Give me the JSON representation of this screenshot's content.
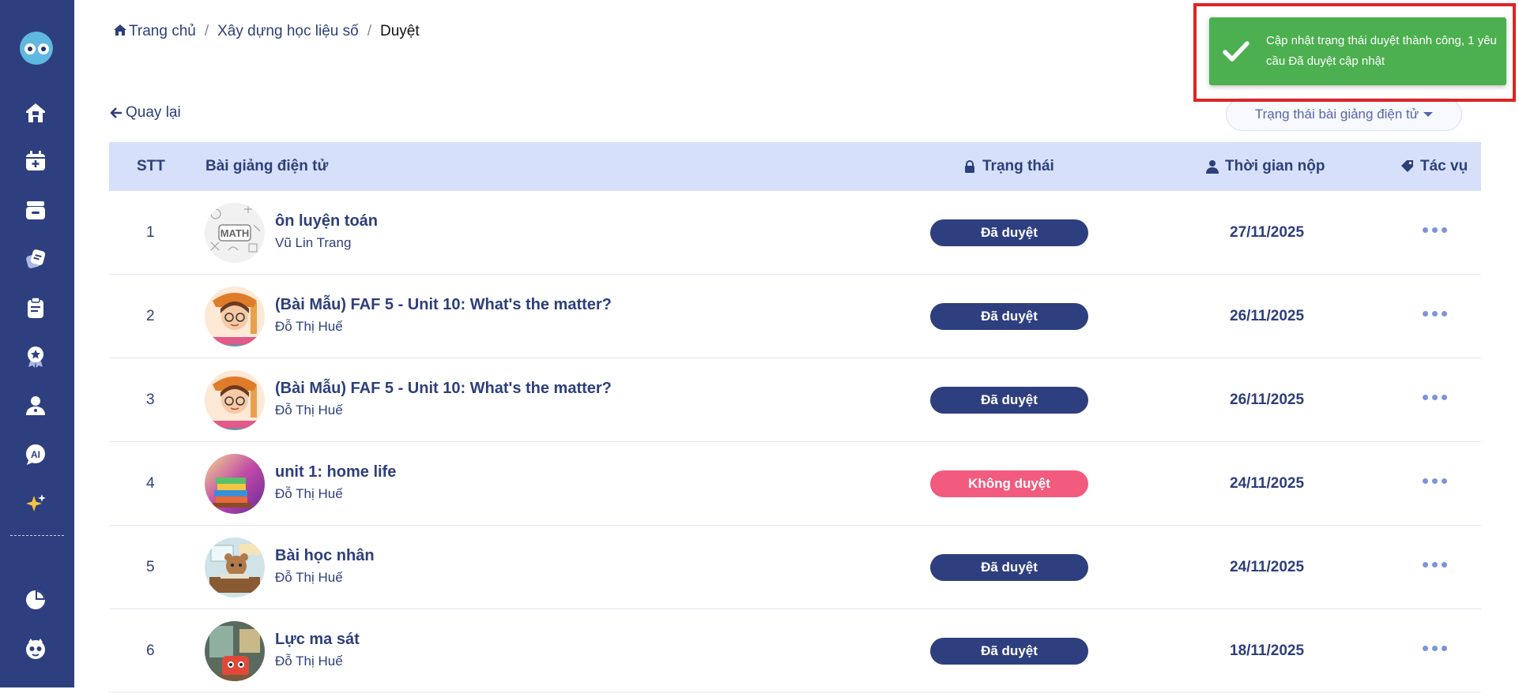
{
  "sidebar": {
    "items": [
      {
        "name": "home-icon"
      },
      {
        "name": "calendar-plus-icon"
      },
      {
        "name": "archive-icon"
      },
      {
        "name": "notes-icon"
      },
      {
        "name": "clipboard-icon"
      },
      {
        "name": "award-icon"
      },
      {
        "name": "users-icon"
      },
      {
        "name": "ai-chat-icon"
      },
      {
        "name": "sparkle-icon"
      },
      {
        "name": "pie-chart-icon"
      },
      {
        "name": "bot-icon"
      }
    ]
  },
  "breadcrumb": {
    "home": "Trang chủ",
    "sep": "/",
    "section": "Xây dựng học liệu số",
    "current": "Duyệt"
  },
  "back_label": "Quay lại",
  "status_filter": {
    "label": "Trạng thái bài giảng điện tử"
  },
  "toast": {
    "message": "Cập nhật trạng thái duyệt thành công, 1 yêu cầu Đã duyệt cập nhật",
    "color": "#4caf50",
    "highlight_color": "#e02424"
  },
  "table": {
    "headers": {
      "stt": "STT",
      "lesson": "Bài giảng điện tử",
      "status": "Trạng thái",
      "time": "Thời gian nộp",
      "actions": "Tác vụ"
    },
    "rows": [
      {
        "stt": "1",
        "title": "ôn luyện toán",
        "author": "Vũ Lin Trang",
        "status": "Đã duyệt",
        "status_color": "#2e3f7f",
        "date": "27/11/2025",
        "thumb": "math-doodle"
      },
      {
        "stt": "2",
        "title": "(Bài Mẫu) FAF 5 - Unit 10: What's the matter?",
        "author": "Đỗ Thị Huế",
        "status": "Đã duyệt",
        "status_color": "#2e3f7f",
        "date": "26/11/2025",
        "thumb": "girl-cartoon"
      },
      {
        "stt": "3",
        "title": "(Bài Mẫu) FAF 5 - Unit 10: What's the matter?",
        "author": "Đỗ Thị Huế",
        "status": "Đã duyệt",
        "status_color": "#2e3f7f",
        "date": "26/11/2025",
        "thumb": "girl-cartoon"
      },
      {
        "stt": "4",
        "title": "unit 1: home life",
        "author": "Đỗ Thị Huế",
        "status": "Không duyệt",
        "status_color": "#f25a7e",
        "date": "24/11/2025",
        "thumb": "books"
      },
      {
        "stt": "5",
        "title": "Bài học nhân",
        "author": "Đỗ Thị Huế",
        "status": "Đã duyệt",
        "status_color": "#2e3f7f",
        "date": "24/11/2025",
        "thumb": "classroom-bear"
      },
      {
        "stt": "6",
        "title": "Lực ma sát",
        "author": "Đỗ Thị Huế",
        "status": "Đã duyệt",
        "status_color": "#2e3f7f",
        "date": "18/11/2025",
        "thumb": "red-robot"
      }
    ]
  },
  "colors": {
    "sidebar": "#2e3f7f",
    "header_bg": "#d6e0fa",
    "text": "#2d3f7a",
    "approved": "#2e3f7f",
    "rejected": "#f25a7e"
  }
}
